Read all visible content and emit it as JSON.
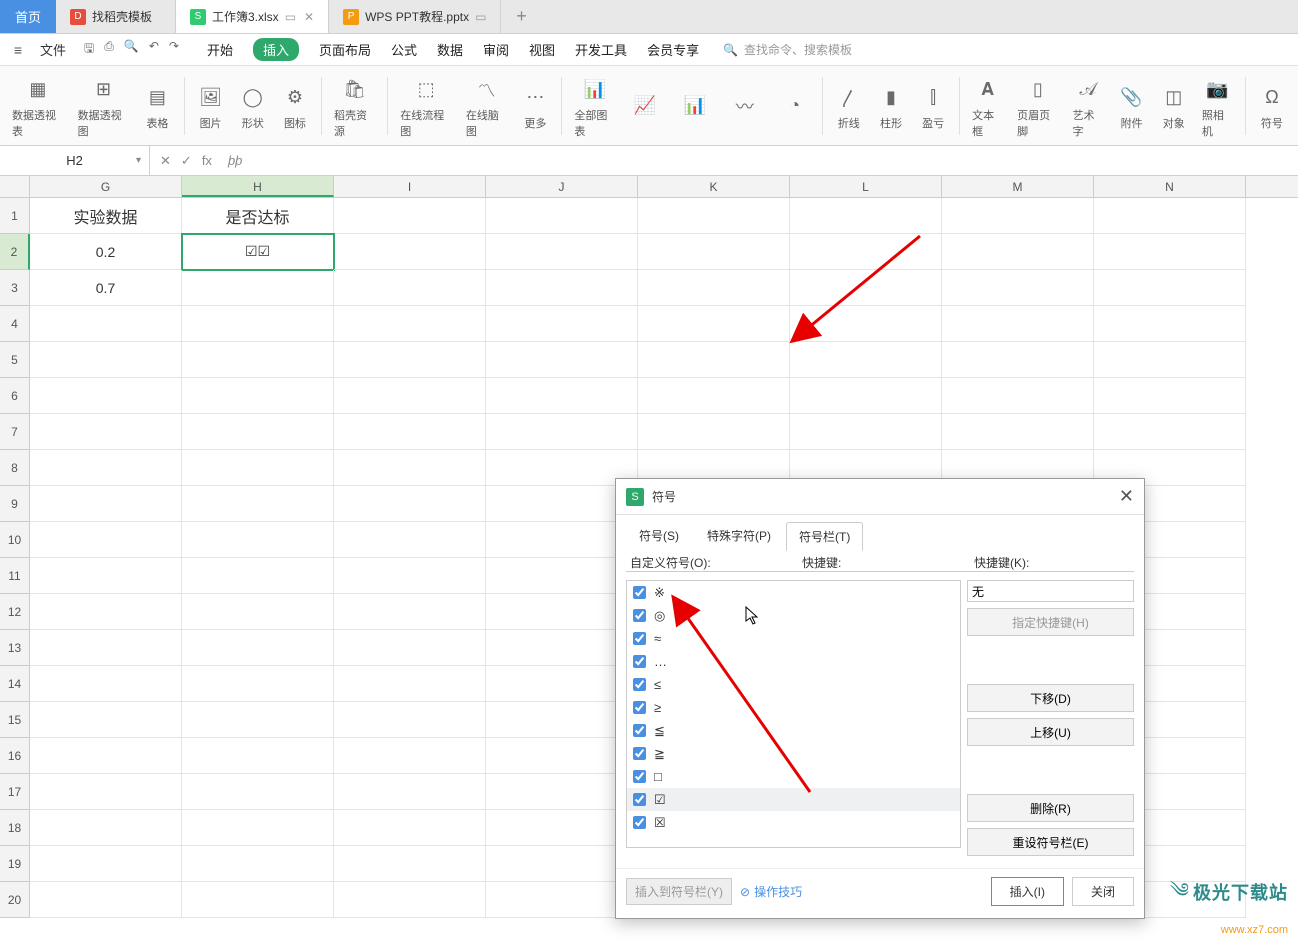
{
  "titlebar": {
    "home": "首页",
    "tabs": [
      {
        "label": "找稻壳模板",
        "icon": "red",
        "glyph": "D"
      },
      {
        "label": "工作簿3.xlsx",
        "icon": "green",
        "glyph": "S"
      },
      {
        "label": "WPS PPT教程.pptx",
        "icon": "orange",
        "glyph": "P"
      }
    ],
    "active_tab_index": 1,
    "add": "+"
  },
  "menu": {
    "file": "文件",
    "items": [
      "开始",
      "插入",
      "页面布局",
      "公式",
      "数据",
      "审阅",
      "视图",
      "开发工具",
      "会员专享"
    ],
    "active_index": 1,
    "search_placeholder": "查找命令、搜索模板"
  },
  "ribbon": {
    "groups": [
      "数据透视表",
      "数据透视图",
      "表格",
      "图片",
      "形状",
      "图标",
      "稻壳资源",
      "在线流程图",
      "在线脑图",
      "更多",
      "全部图表",
      "折线",
      "柱形",
      "盈亏",
      "文本框",
      "页眉页脚",
      "艺术字",
      "附件",
      "对象",
      "照相机",
      "符号"
    ]
  },
  "formula_bar": {
    "name_box": "H2",
    "fx_symbols": {
      "cancel": "✕",
      "enter": "✓",
      "fx": "fx"
    },
    "content": "þþ"
  },
  "grid": {
    "columns": [
      "G",
      "H",
      "I",
      "J",
      "K",
      "L",
      "M",
      "N"
    ],
    "active_col_index": 1,
    "active_row_index": 1,
    "rows": [
      {
        "h": "1",
        "cells": [
          "实验数据",
          "是否达标",
          "",
          "",
          "",
          "",
          "",
          ""
        ]
      },
      {
        "h": "2",
        "cells": [
          "0.2",
          "☑☑",
          "",
          "",
          "",
          "",
          "",
          ""
        ]
      },
      {
        "h": "3",
        "cells": [
          "0.7",
          "",
          "",
          "",
          "",
          "",
          "",
          ""
        ]
      },
      {
        "h": "4",
        "cells": [
          "",
          "",
          "",
          "",
          "",
          "",
          "",
          ""
        ]
      },
      {
        "h": "5",
        "cells": [
          "",
          "",
          "",
          "",
          "",
          "",
          "",
          ""
        ]
      },
      {
        "h": "6",
        "cells": [
          "",
          "",
          "",
          "",
          "",
          "",
          "",
          ""
        ]
      },
      {
        "h": "7",
        "cells": [
          "",
          "",
          "",
          "",
          "",
          "",
          "",
          ""
        ]
      },
      {
        "h": "8",
        "cells": [
          "",
          "",
          "",
          "",
          "",
          "",
          "",
          ""
        ]
      },
      {
        "h": "9",
        "cells": [
          "",
          "",
          "",
          "",
          "",
          "",
          "",
          ""
        ]
      },
      {
        "h": "10",
        "cells": [
          "",
          "",
          "",
          "",
          "",
          "",
          "",
          ""
        ]
      },
      {
        "h": "11",
        "cells": [
          "",
          "",
          "",
          "",
          "",
          "",
          "",
          ""
        ]
      },
      {
        "h": "12",
        "cells": [
          "",
          "",
          "",
          "",
          "",
          "",
          "",
          ""
        ]
      },
      {
        "h": "13",
        "cells": [
          "",
          "",
          "",
          "",
          "",
          "",
          "",
          ""
        ]
      },
      {
        "h": "14",
        "cells": [
          "",
          "",
          "",
          "",
          "",
          "",
          "",
          ""
        ]
      },
      {
        "h": "15",
        "cells": [
          "",
          "",
          "",
          "",
          "",
          "",
          "",
          ""
        ]
      },
      {
        "h": "16",
        "cells": [
          "",
          "",
          "",
          "",
          "",
          "",
          "",
          ""
        ]
      },
      {
        "h": "17",
        "cells": [
          "",
          "",
          "",
          "",
          "",
          "",
          "",
          ""
        ]
      },
      {
        "h": "18",
        "cells": [
          "",
          "",
          "",
          "",
          "",
          "",
          "",
          ""
        ]
      },
      {
        "h": "19",
        "cells": [
          "",
          "",
          "",
          "",
          "",
          "",
          "",
          ""
        ]
      },
      {
        "h": "20",
        "cells": [
          "",
          "",
          "",
          "",
          "",
          "",
          "",
          ""
        ]
      }
    ]
  },
  "dialog": {
    "title": "符号",
    "tabs": [
      "符号(S)",
      "特殊字符(P)",
      "符号栏(T)"
    ],
    "active_tab_index": 2,
    "labels": {
      "custom": "自定义符号(O):",
      "shortcut": "快捷键:",
      "key": "快捷键(K):"
    },
    "shortcut_value": "无",
    "buttons": {
      "assign": "指定快捷键(H)",
      "down": "下移(D)",
      "up": "上移(U)",
      "delete": "删除(R)",
      "reset": "重设符号栏(E)",
      "insert_bar": "插入到符号栏(Y)",
      "help_icon": "⊘",
      "help": "操作技巧",
      "insert": "插入(I)",
      "close": "关闭"
    },
    "symbols": [
      "※",
      "◎",
      "≈",
      "…",
      "≤",
      "≥",
      "≦",
      "≧",
      "□",
      "☑",
      "☒"
    ],
    "selected_symbol_index": 9
  },
  "watermark": {
    "line1": "极光下载站",
    "line2": "www.xz7.com"
  }
}
